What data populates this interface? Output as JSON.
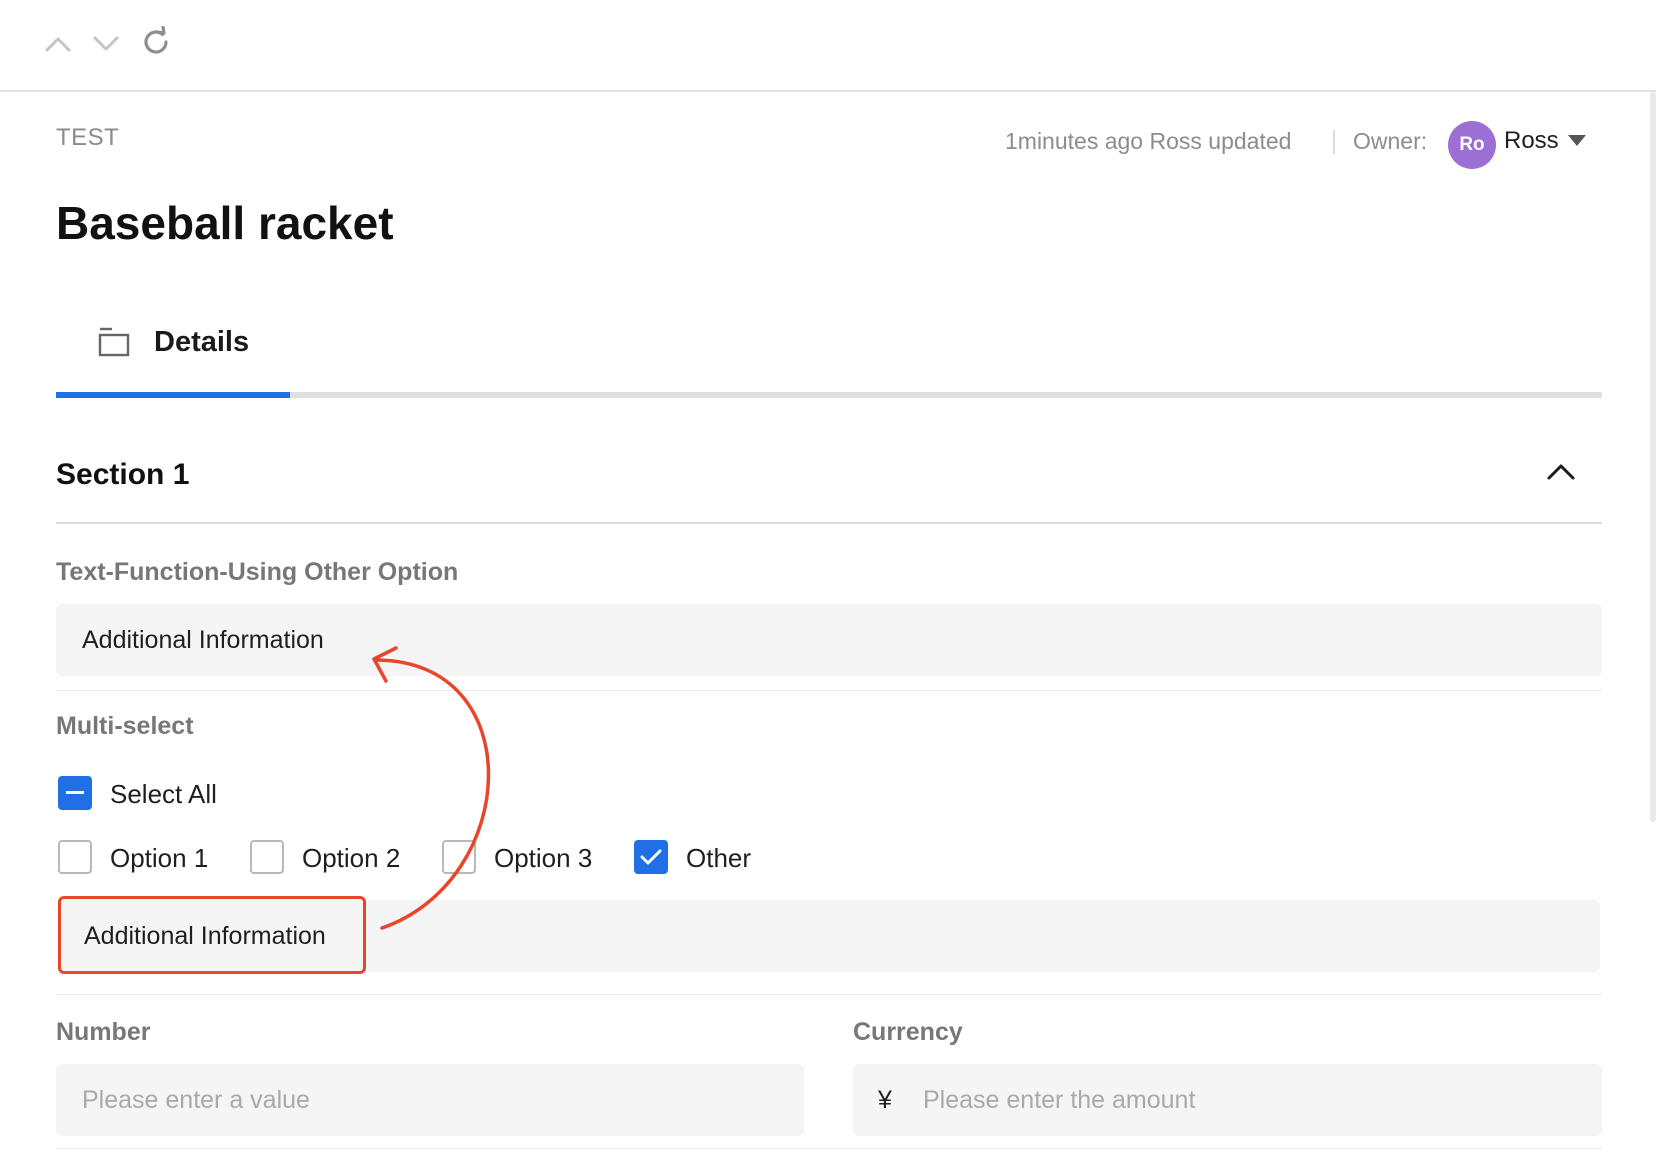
{
  "toolbar": {
    "prev_icon": "chevron-up-icon",
    "next_icon": "chevron-down-icon",
    "refresh_icon": "refresh-icon"
  },
  "header": {
    "breadcrumb": "TEST",
    "update_info": "1minutes ago Ross updated",
    "owner_label": "Owner:",
    "owner_initials": "Ro",
    "owner_name": "Ross"
  },
  "record": {
    "title": "Baseball racket"
  },
  "tabs": [
    {
      "label": "Details",
      "icon": "folder-icon",
      "active": true
    }
  ],
  "section": {
    "title": "Section 1",
    "expanded": true
  },
  "fields": {
    "text_other": {
      "label": "Text-Function-Using Other Option",
      "value": "Additional Information"
    },
    "multiselect": {
      "label": "Multi-select",
      "select_all_label": "Select All",
      "options": [
        {
          "label": "Option 1",
          "checked": false
        },
        {
          "label": "Option 2",
          "checked": false
        },
        {
          "label": "Option 3",
          "checked": false
        },
        {
          "label": "Other",
          "checked": true
        }
      ],
      "other_value": "Additional Information"
    },
    "number": {
      "label": "Number",
      "placeholder": "Please enter a value"
    },
    "currency": {
      "label": "Currency",
      "symbol": "¥",
      "placeholder": "Please enter the amount"
    }
  },
  "colors": {
    "accent": "#1f6fe5",
    "annotation": "#e8462a",
    "avatar": "#9b6fd4"
  }
}
